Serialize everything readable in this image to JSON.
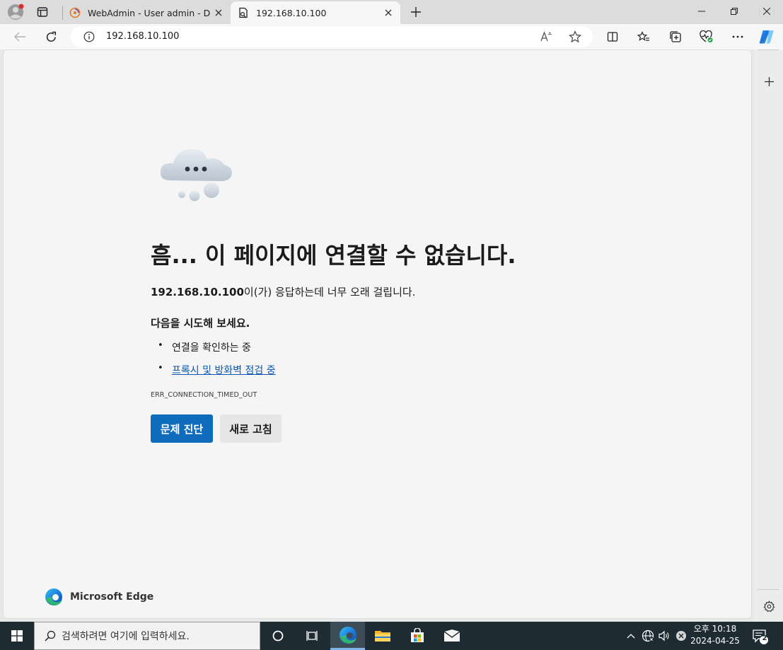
{
  "tabs": [
    {
      "title": "WebAdmin - User admin - Device"
    },
    {
      "title": "192.168.10.100"
    }
  ],
  "address": {
    "url": "192.168.10.100"
  },
  "error": {
    "heading": "흠... 이 페이지에 연결할 수 없습니다.",
    "host": "192.168.10.100",
    "desc_rest": "이(가) 응답하는데 너무 오래 걸립니다.",
    "try_title": "다음을 시도해 보세요.",
    "suggestions": [
      "연결을 확인하는 중",
      "프록시 및 방화벽 점검 중"
    ],
    "code": "ERR_CONNECTION_TIMED_OUT",
    "diagnose_label": "문제 진단",
    "refresh_label": "새로 고침"
  },
  "brand": {
    "name": "Microsoft Edge"
  },
  "taskbar": {
    "search_placeholder": "검색하려면 여기에 입력하세요.",
    "time": "오후 10:18",
    "date": "2024-04-25",
    "notification_count": "2"
  },
  "colors": {
    "accent": "#0f6cbd",
    "link": "#0b57b0",
    "taskbar": "#1f2b33"
  }
}
